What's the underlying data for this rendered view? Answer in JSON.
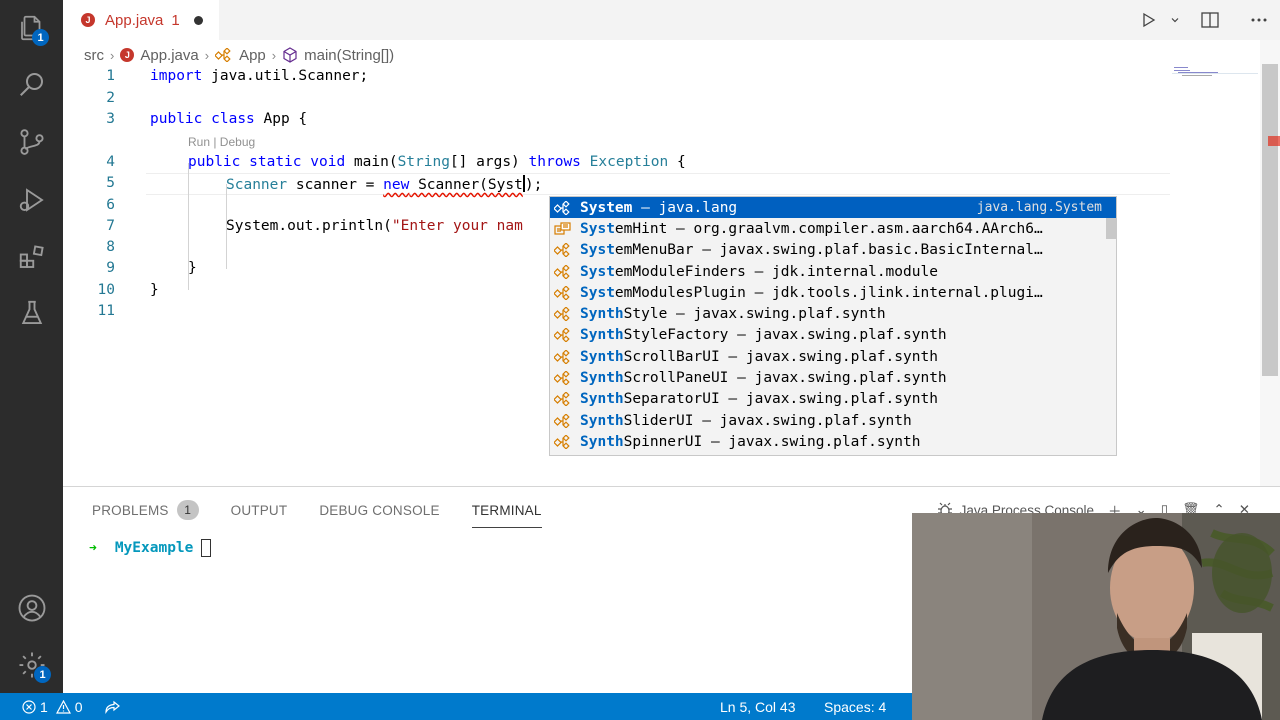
{
  "activity_bar": {
    "explorer_badge": "1",
    "settings_badge": "1"
  },
  "tab": {
    "file_name": "App.java",
    "problem_count": "1",
    "icon_letter": "J"
  },
  "breadcrumb": {
    "folder": "src",
    "file": "App.java",
    "class": "App",
    "method": "main(String[])"
  },
  "editor": {
    "line_numbers": [
      "1",
      "2",
      "3",
      "4",
      "5",
      "6",
      "7",
      "8",
      "9",
      "10",
      "11"
    ],
    "codelens": "Run | Debug",
    "lines": {
      "l1_kw": "import",
      "l1_rest": " java.util.Scanner;",
      "l3_kw1": "public",
      "l3_kw2": "class",
      "l3_rest": " App {",
      "l4_kw1": "public",
      "l4_kw2": "static",
      "l4_kw3": "void",
      "l4_name": " main(",
      "l4_type": "String",
      "l4_args": "[] args) ",
      "l4_kw4": "throws",
      "l4_exc": "Exception",
      "l4_end": " {",
      "l5_type": "Scanner",
      "l5_mid": " scanner = ",
      "l5_new": "new",
      "l5_call": " Scanner(Syst",
      "l5_end": ");",
      "l7_call": "System.out.println(",
      "l7_str": "\"Enter your nam",
      "l9": "}",
      "l10": "}"
    }
  },
  "suggestions": [
    {
      "match": "System",
      "rest": " – java.lang",
      "detail": "java.lang.System",
      "icon": "class-icon"
    },
    {
      "match": "Syst",
      "rest": "emHint – org.graalvm.compiler.asm.aarch64.AArch6…",
      "icon": "enum-icon"
    },
    {
      "match": "Syst",
      "rest": "emMenuBar – javax.swing.plaf.basic.BasicInternal…",
      "icon": "class-icon"
    },
    {
      "match": "Syst",
      "rest": "emModuleFinders – jdk.internal.module",
      "icon": "class-icon"
    },
    {
      "match": "Syst",
      "rest": "emModulesPlugin – jdk.tools.jlink.internal.plugi…",
      "icon": "class-icon"
    },
    {
      "match": "Synth",
      "rest": "Style – javax.swing.plaf.synth",
      "icon": "class-icon"
    },
    {
      "match": "Synth",
      "rest": "StyleFactory – javax.swing.plaf.synth",
      "icon": "class-icon"
    },
    {
      "match": "Synth",
      "rest": "ScrollBarUI – javax.swing.plaf.synth",
      "icon": "class-icon"
    },
    {
      "match": "Synth",
      "rest": "ScrollPaneUI – javax.swing.plaf.synth",
      "icon": "class-icon"
    },
    {
      "match": "Synth",
      "rest": "SeparatorUI – javax.swing.plaf.synth",
      "icon": "class-icon"
    },
    {
      "match": "Synth",
      "rest": "SliderUI – javax.swing.plaf.synth",
      "icon": "class-icon"
    },
    {
      "match": "Synth",
      "rest": "SpinnerUI – javax.swing.plaf.synth",
      "icon": "class-icon"
    }
  ],
  "panel": {
    "tabs": [
      "PROBLEMS",
      "OUTPUT",
      "DEBUG CONSOLE",
      "TERMINAL"
    ],
    "problems_count": "1",
    "active_tab": "TERMINAL",
    "terminal_name": "Java Process Console",
    "prompt_arrow": "➜",
    "prompt_dir": "MyExample"
  },
  "status_bar": {
    "errors": "1",
    "warnings": "0",
    "position": "Ln 5, Col 43",
    "spaces": "Spaces: 4"
  },
  "colors": {
    "accent": "#007acc",
    "selection": "#0060c0",
    "error": "#c5372c"
  }
}
